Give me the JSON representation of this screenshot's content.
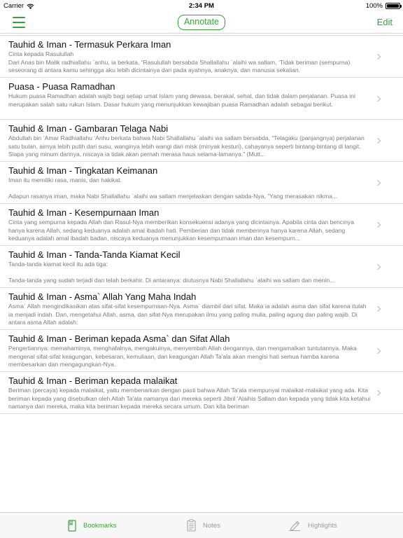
{
  "status": {
    "carrier": "Carrier",
    "time": "2:34 PM",
    "battery": "100%",
    "battery_level": 1.0
  },
  "nav": {
    "annotate_label": "Annotate",
    "edit_label": "Edit"
  },
  "items": [
    {
      "title": "Tauhid & Iman - Termasuk Perkara Iman",
      "preview": "Cinta kepada Rasulullah\nDari Anas bin Malik radhiallahu `anhu, ia berkata, “Rasulullah bersabda Shallallahu `alaihi wa sallam, ‘Tidak beriman (sempurna) seseorang di antara kamu sehingga aku lebih dicintainya dari pada ayahnya, anaknya, dan manusia sekalian."
    },
    {
      "title": "Puasa - Puasa Ramadhan",
      "preview": "Hukum puasa Ramadhan adalah wajib bagi setiap umat Islam yang dewasa, berakal, sehat, dan tidak dalam perjalanan. Puasa ini merupakan salah satu rukun Islam. Dasar hukum yang menunjukkan kewajiban puasa Ramadhan adalah sebagai berikut."
    },
    {
      "title": "Tauhid & Iman - Gambaran Telaga Nabi",
      "preview": "Abdullah bin ‘Amar Radhiallahu ‘Anhu berkata bahwa Nabi Shallallahu `alaihi wa sallam bersabda, “Telagaku (panjangnya) perjalanan satu bulan, airnya lebih putih dari susu, wanginya lebih wangi dari misk (minyak kesturi), cahayanya seperti bintang-bintang di langit. Siapa yang minum darinya, niscaya ia tidak akan pernah merasa haus selama-lamanya.” (Mutt..."
    },
    {
      "title": "Tauhid & Iman - Tingkatan Keimanan",
      "preview": "Iman itu memiliki rasa, manis, dan hakikat.\n\nAdapun rasanya iman, maka Nabi Shallallahu `alaihi wa sallam menjelaskan dengan sabda-Nya, \"Yang merasakan nikma..."
    },
    {
      "title": "Tauhid & Iman - Kesempurnaan Iman",
      "preview": "Cinta yang sempurna kepada Allah dan Rasul-Nya memberikan konsekuensi adanya yang dicintainya. Apabila cinta dan bencinya hanya karena Allah, sedang keduanya adalah amal ibadah hati. Pemberian dan tidak memberinya hanya karena Allah, sedang keduanya adalah amal ibadah badan, niscaya keduanya menunjukkan kesempurnaan iman dan kesempurn..."
    },
    {
      "title": "Tauhid & Iman - Tanda-Tanda Kiamat Kecil",
      "preview": "Tanda-tanda kiamat kecil itu ada tiga:\n\nTanda-tanda yang sudah terjadi dan telah berkahir. Di antaranya: diutusnya Nabi Shallallahu `alaihi wa sallam dan menin..."
    },
    {
      "title": "Tauhid & Iman - Asma` Allah Yang Maha Indah",
      "preview": "Asma` Allah mengindikasikan atas sifat-sifat kesempurnaan-Nya. Asma` diambil dari sifat. Maka ia adalah asma dan sifat karena itulah ia menjadi indah. Dan, mengetahui Allah, asma, dan sifat-Nya merupakan ilmu yang paling mulia, paling agung dan paling wajib. Di antara asma Allah adalah:"
    },
    {
      "title": "Tauhid & Iman - Beriman kepada Asma` dan Sifat Allah",
      "preview": "Pengertiannya: memahaminya, menghafalnya, mengakuinya, menyembah Allah dengannya, dan mengamalkan tuntutannya. Maka mengenal sifat-sifat keagungan, kebesaran, kemuliaan, dan keagungan Allah Ta'ala akan mengisi hati semua hamba karena membesarkan dan mengagungkan-Nya."
    },
    {
      "title": "Tauhid & Iman - Beriman kepada malaikat",
      "preview": "Beriman (percaya) kepada malaikat, yaitu membenarkan dengan pasti bahwa Allah Ta'ala mempunyai malaikat-malaikat yang ada. Kita beriman kepada yang disebutkan oleh Allah Ta'ala namanya dari mereka seperti Jibril 'Alaihis Sallam dan kepada yang tidak kita ketahui namanya dari mereka, maka kita beriman kepada mereka secara umum. Dan kita beriman"
    }
  ],
  "tabs": {
    "bookmarks": "Bookmarks",
    "notes": "Notes",
    "highlights": "Highlights"
  },
  "colors": {
    "accent": "#3aa03a",
    "inactive_tab": "#9a9a9a",
    "preview_text": "#7a7a7a"
  }
}
